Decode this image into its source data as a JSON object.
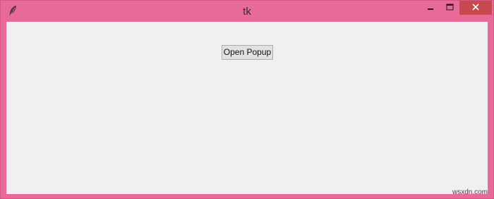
{
  "window": {
    "title": "tk",
    "frame_color": "#e86a98",
    "close_color": "#c7494f",
    "client_bg": "#f0f0f0"
  },
  "controls": {
    "minimize_icon": "minimize-icon",
    "maximize_icon": "maximize-icon",
    "close_icon": "close-icon"
  },
  "main": {
    "open_popup_label": "Open Popup"
  },
  "watermark": {
    "text": "wsxdn.com"
  }
}
